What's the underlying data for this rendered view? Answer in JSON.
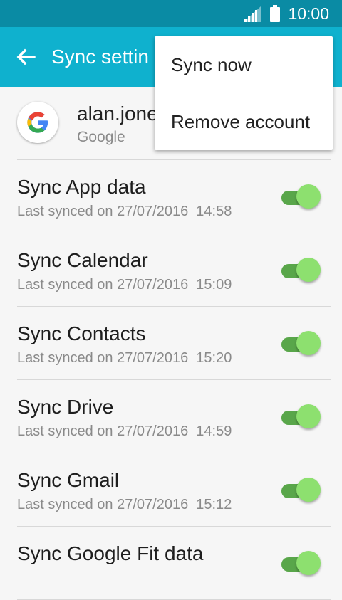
{
  "status_bar": {
    "time": "10:00",
    "signal_icon": "signal-icon",
    "battery_icon": "battery-icon"
  },
  "app_bar": {
    "title": "Sync settin",
    "back_icon": "back-arrow-icon"
  },
  "account": {
    "email": "alan.jone",
    "type": "Google",
    "avatar_icon": "google-icon"
  },
  "sync_items": [
    {
      "title": "Sync App data",
      "subtitle": "Last synced on 27/07/2016  14:58",
      "enabled": true
    },
    {
      "title": "Sync Calendar",
      "subtitle": "Last synced on 27/07/2016  15:09",
      "enabled": true
    },
    {
      "title": "Sync Contacts",
      "subtitle": "Last synced on 27/07/2016  15:20",
      "enabled": true
    },
    {
      "title": "Sync Drive",
      "subtitle": "Last synced on 27/07/2016  14:59",
      "enabled": true
    },
    {
      "title": "Sync Gmail",
      "subtitle": "Last synced on 27/07/2016  15:12",
      "enabled": true
    },
    {
      "title": "Sync Google Fit data",
      "subtitle": "",
      "enabled": true
    }
  ],
  "menu": {
    "items": [
      {
        "label": "Sync now"
      },
      {
        "label": "Remove account"
      }
    ]
  },
  "colors": {
    "status_bar": "#0a8ba4",
    "app_bar": "#0fb1ce",
    "toggle_track": "#59a64a",
    "toggle_thumb": "#8de06f",
    "background": "#f6f6f6"
  }
}
